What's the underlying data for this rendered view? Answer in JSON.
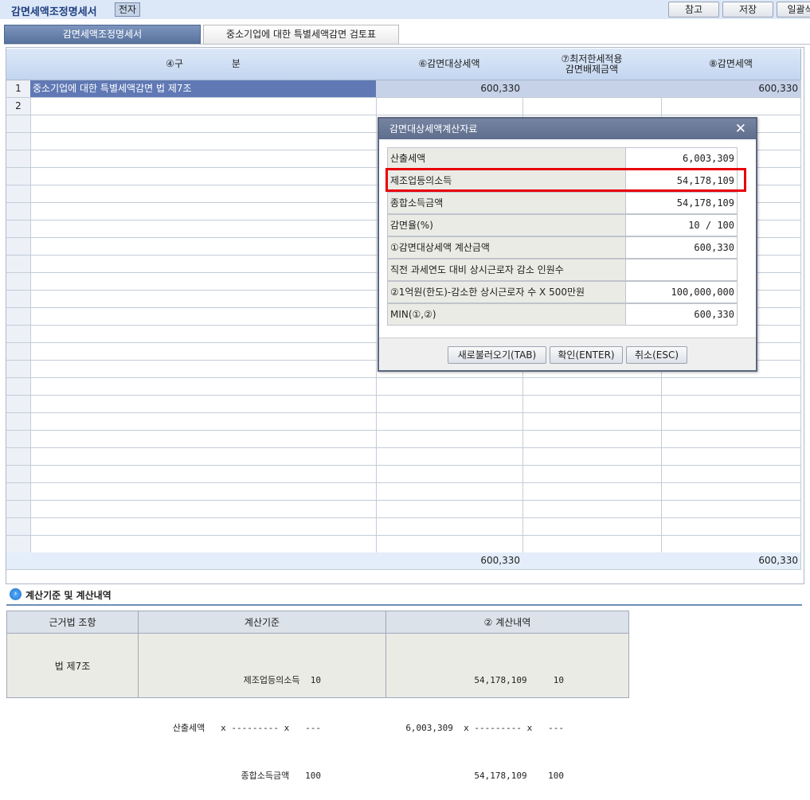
{
  "header": {
    "title": "감면세액조정명세서",
    "tag": "전자",
    "buttons": [
      "참고",
      "저장",
      "일괄삭"
    ]
  },
  "tabs": [
    {
      "label": "감면세액조정명세서",
      "active": true
    },
    {
      "label": "중소기업에 대한 특별세액감면 검토표",
      "active": false
    }
  ],
  "grid": {
    "columns": [
      "④구                분",
      "⑥감면대상세액",
      "⑦최저한세적용\n감면배제금액",
      "⑧감면세액"
    ],
    "rows": [
      {
        "num": "1",
        "name": "중소기업에 대한 특별세액감면 법 제7조",
        "target": "600,330",
        "excluded": "",
        "reduction": "600,330"
      },
      {
        "num": "2",
        "name": "",
        "target": "",
        "excluded": "",
        "reduction": ""
      }
    ],
    "totals": {
      "target": "600,330",
      "excluded": "",
      "reduction": "600,330"
    }
  },
  "dialog": {
    "title": "감면대상세액계산자료",
    "close_icon": "close-icon",
    "rows": [
      {
        "label": "산출세액",
        "value": "6,003,309"
      },
      {
        "label": "제조업등의소득",
        "value": "54,178,109"
      },
      {
        "label": "종합소득금액",
        "value": "54,178,109"
      },
      {
        "label": "감면율(%)",
        "value": "10 / 100"
      },
      {
        "label": "①감면대상세액 계산금액",
        "value": "600,330"
      },
      {
        "label": "직전 과세연도 대비 상시근로자 감소 인원수",
        "value": ""
      },
      {
        "label": "②1억원(한도)-감소한 상시근로자 수 X 500만원",
        "value": "100,000,000"
      },
      {
        "label": "MIN(①,②)",
        "value": "600,330"
      }
    ],
    "buttons": {
      "reload": "새로불러오기(TAB)",
      "ok": "확인(ENTER)",
      "cancel": "취소(ESC)"
    },
    "highlight_color": "#e8000a"
  },
  "calc_section": {
    "title": "계산기준 및 계산내역",
    "headers": [
      "근거법 조항",
      "계산기준",
      "② 계산내역"
    ],
    "law": "법 제7조",
    "basis": [
      "제조업등의소득  10",
      "산출세액   x --------- x   ---",
      "종합소득금액   100"
    ],
    "detail": [
      "54,178,109     10",
      "6,003,309  x --------- x   ---",
      "54,178,109    100"
    ]
  }
}
